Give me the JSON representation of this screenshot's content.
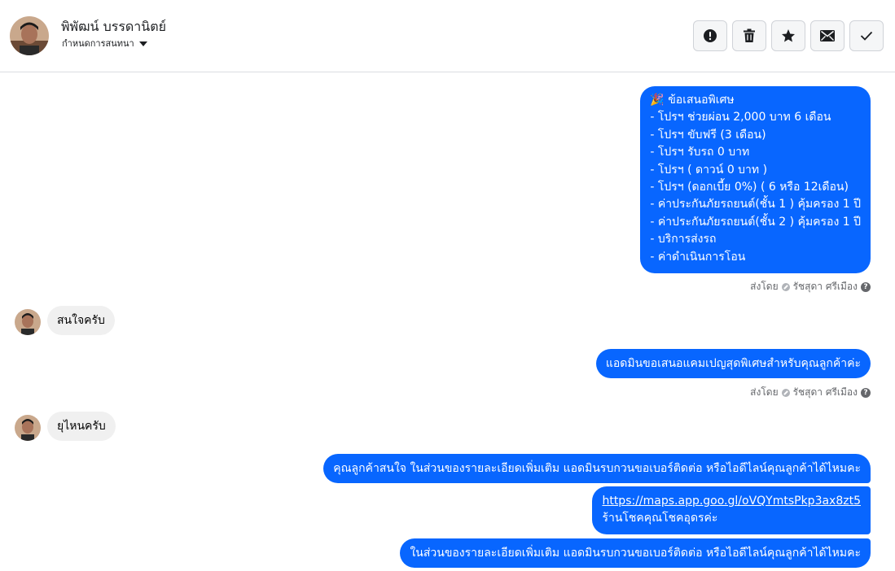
{
  "header": {
    "contact_name": "พิพัฒน์ บรรดานิตย์",
    "assign_label": "กำหนดการสนทนา",
    "actions": [
      {
        "name": "report-button",
        "icon": "alert-circle-icon"
      },
      {
        "name": "delete-button",
        "icon": "trash-icon"
      },
      {
        "name": "star-button",
        "icon": "star-icon"
      },
      {
        "name": "mark-unread-button",
        "icon": "envelope-icon"
      },
      {
        "name": "mark-done-button",
        "icon": "checkmark-icon"
      }
    ]
  },
  "messages": {
    "offer": {
      "icon": "🎉",
      "lines": [
        "ข้อเสนอพิเศษ",
        "- โปรฯ ช่วยผ่อน 2,000 บาท 6 เดือน",
        "- โปรฯ ขับฟรี (3 เดือน)",
        "- โปรฯ รับรถ 0 บาท",
        "- โปรฯ ( ดาวน์ 0 บาท )",
        "- โปรฯ (ดอกเบี้ย 0%) ( 6 หรือ 12เดือน)",
        "- ค่าประกันภัยรถยนต์(ชั้น 1 ) คุ้มครอง 1 ปี",
        "- ค่าประกันภัยรถยนต์(ชั้น 2 ) คุ้มครอง 1 ปี",
        "- บริการส่งรถ",
        "- ค่าดำเนินการโอน"
      ]
    },
    "sent_by_label": "ส่งโดย",
    "sender_name": "รัชสุดา ศรีเมือง",
    "in_1": "สนใจครับ",
    "out_1": "แอดมินขอเสนอแคมเปญสุดพิเศษสำหรับคุณลูกค้าค่ะ",
    "in_2": "ยุไหนครับ",
    "out_2": "คุณลูกค้าสนใจ ในส่วนของรายละเอียดเพิ่มเติม แอดมินรบกวนขอเบอร์ติดต่อ หรือไอดีไลน์คุณลูกค้าได้ไหมคะ",
    "out_3_link": "https://maps.app.goo.gl/oVQYmtsPkp3ax8zt5",
    "out_3_text": "ร้านโชคคุณโชคอุดรค่ะ",
    "out_4": "ในส่วนของรายละเอียดเพิ่มเติม แอดมินรบกวนขอเบอร์ติดต่อ หรือไอดีไลน์คุณลูกค้าได้ไหมคะ"
  },
  "colors": {
    "outgoing_bubble": "#0866ff",
    "incoming_bubble": "#f0f0f0",
    "muted_text": "#65676b"
  }
}
